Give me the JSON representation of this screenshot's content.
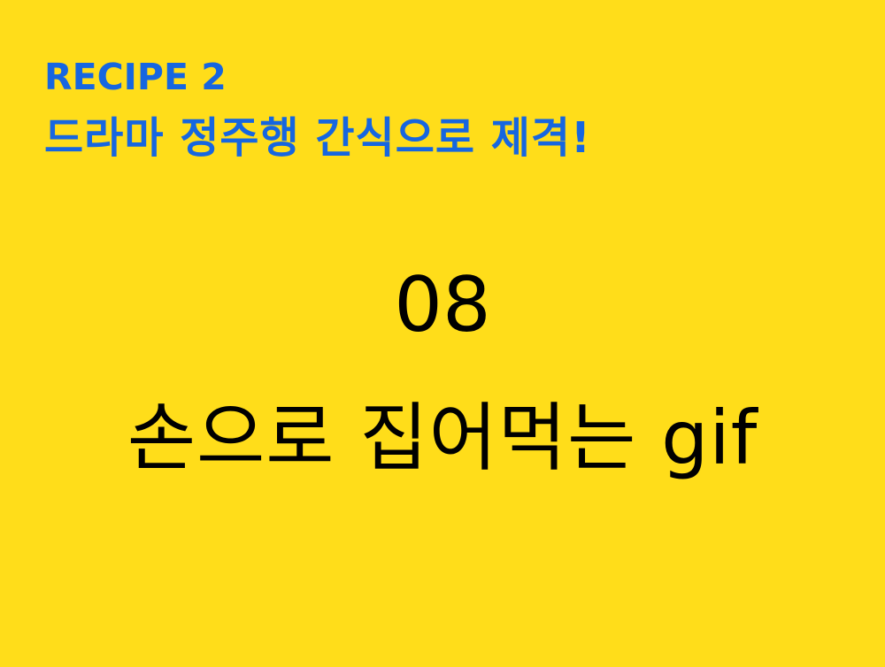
{
  "header": {
    "recipe_label": "RECIPE 2",
    "recipe_title": "드라마 정주행 간식으로 제격!"
  },
  "main": {
    "number": "08",
    "subtitle": "손으로 집어먹는 gif"
  },
  "colors": {
    "background": "#FFDD1A",
    "accent": "#1666E0",
    "text": "#000000"
  }
}
